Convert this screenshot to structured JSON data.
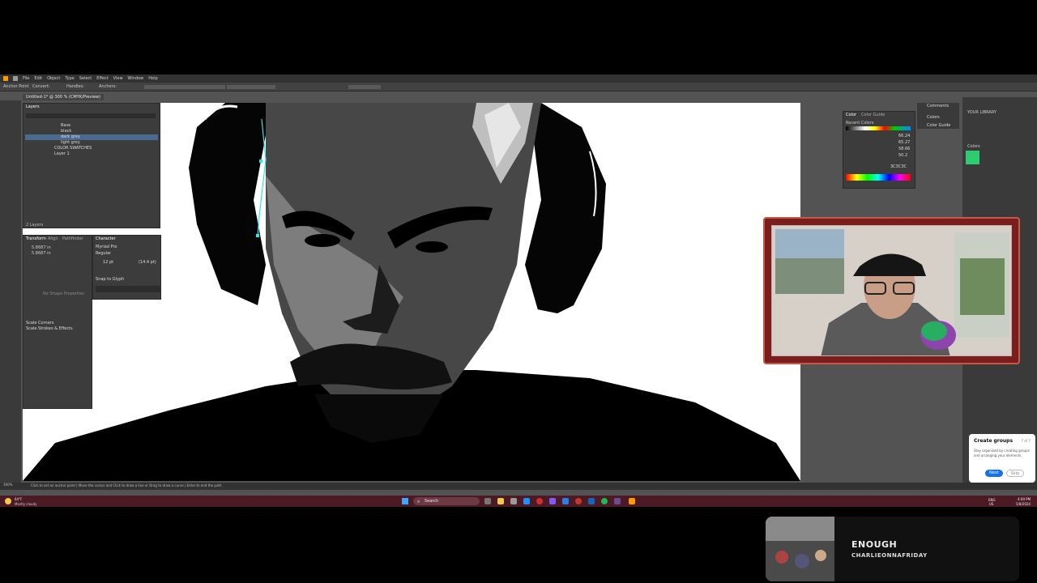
{
  "menu": [
    "File",
    "Edit",
    "Object",
    "Type",
    "Select",
    "Effect",
    "View",
    "Window",
    "Help"
  ],
  "control_bar": {
    "mode": "Anchor Point",
    "convert": "Convert:",
    "handles": "Handles:",
    "anchors": "Anchors:"
  },
  "document": {
    "tab": "Untitled-1* @ 300 % (CMYK/Preview)"
  },
  "layers": {
    "header": "Layers",
    "rows": [
      "Base",
      "black",
      "dark grey",
      "light grey",
      "COLOR SWATCHES",
      "Layer 1"
    ],
    "selected_index": 2,
    "count": "2 Layers"
  },
  "transform_panel": {
    "tabs": [
      "Transform",
      "Align",
      "Pathfinder"
    ],
    "w": "5.8687 in",
    "h": "5.8687 in",
    "empty_note": "No Shape Properties",
    "scale_corners": "Scale Corners",
    "scale_strokes": "Scale Strokes & Effects"
  },
  "character_panel": {
    "header": "Character",
    "font": "Myriad Pro",
    "style": "Regular",
    "size": "12 pt",
    "leading": "(14.4 pt)",
    "snap": "Snap to Glyph"
  },
  "color_panel": {
    "tabs": [
      "Color",
      "Color Guide"
    ],
    "recent": "Recent Colors",
    "values": [
      "66.24",
      "65.27",
      "58.66",
      "50.2"
    ],
    "hex": "3C3C3C"
  },
  "right_panels": {
    "comments": "Comments",
    "colors": "Colors",
    "color_guide": "Color Guide",
    "library": "YOUR LIBRARY",
    "library_section": "Colors",
    "library_swatch": "#2ecc71"
  },
  "tooltip": {
    "title": "Create groups",
    "step": "7 of 7",
    "body": "Stay organized by creating groups and arranging your elements.",
    "next": "Next",
    "skip": "Skip"
  },
  "status_bar": {
    "zoom": "300%",
    "hint": "Click to set an anchor point  |  Move the cursor and Click to draw a line or Drag to draw a curve  |  Enter to end the path"
  },
  "taskbar": {
    "weather_temp": "64°F",
    "weather_desc": "Mostly cloudy",
    "search": "Search",
    "lang_top": "ENG",
    "lang_bottom": "US",
    "time": "4:00 PM",
    "date": "5/8/2024"
  },
  "now_playing": {
    "title": "ENOUGH",
    "artist": "CHARLIEONNAFRIDAY"
  },
  "colors": {
    "accent_blue": "#1473e6",
    "taskbar": "#4b1a24",
    "webcam_frame": "#7a1d1d"
  }
}
